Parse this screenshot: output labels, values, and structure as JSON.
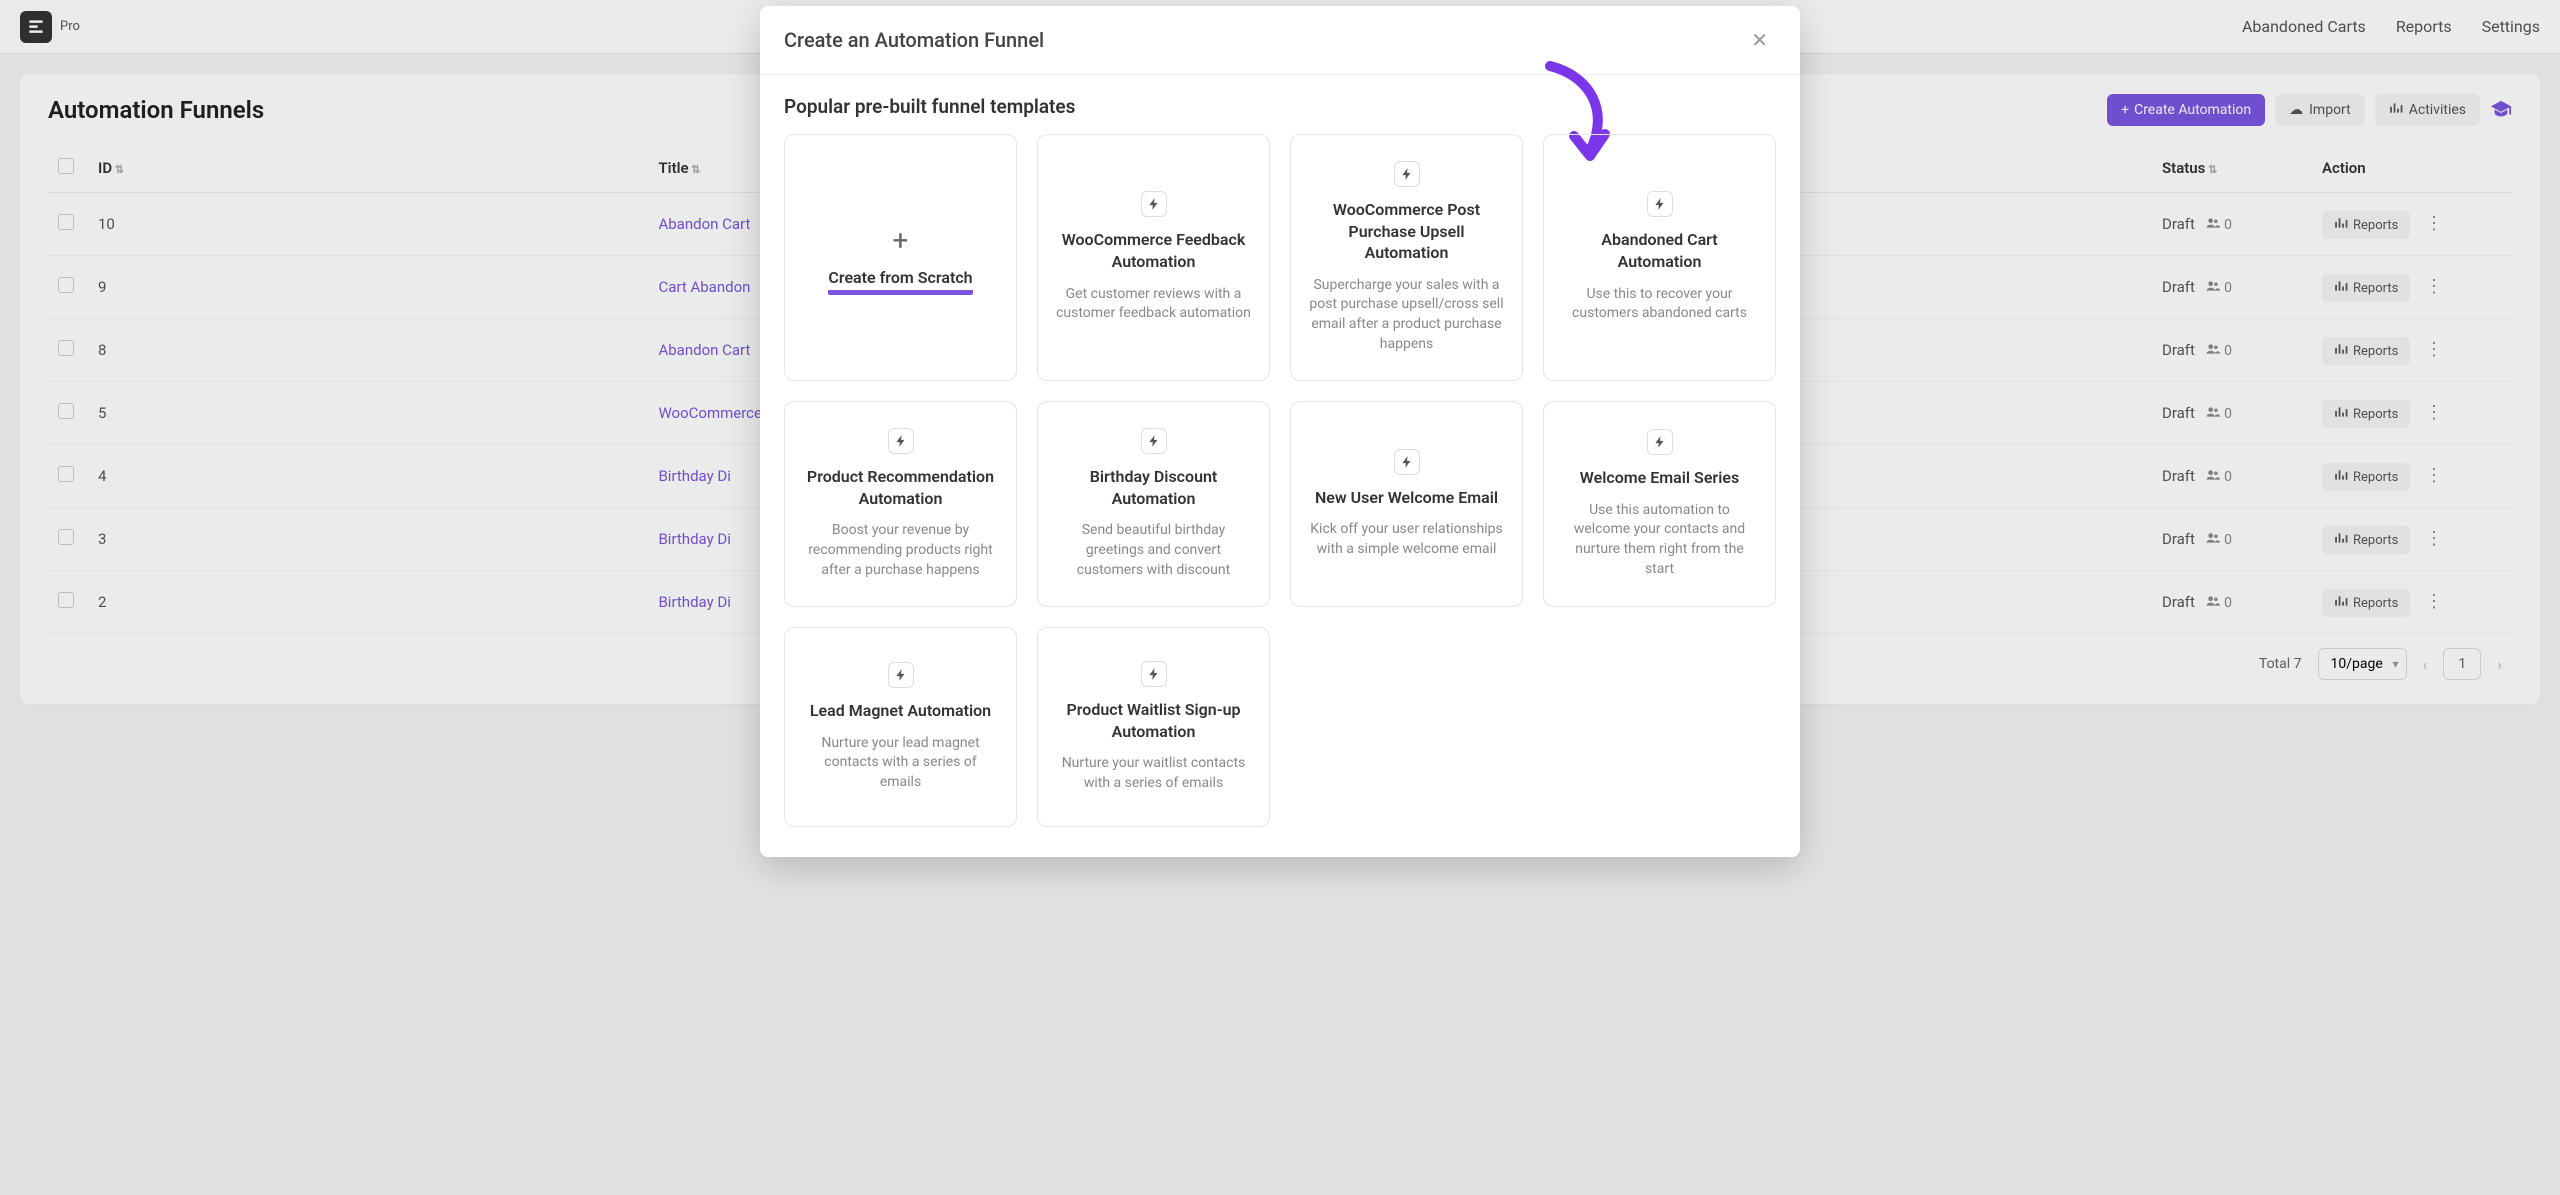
{
  "nav": {
    "pro_label": "Pro",
    "links": {
      "abandoned_carts": "Abandoned Carts",
      "reports": "Reports",
      "settings": "Settings"
    }
  },
  "page": {
    "title": "Automation Funnels",
    "actions": {
      "create": "Create Automation",
      "import": "Import",
      "activities": "Activities"
    }
  },
  "table": {
    "headers": {
      "id": "ID",
      "title": "Title",
      "status": "Status",
      "action": "Action"
    },
    "rows": [
      {
        "id": "10",
        "title": "Abandon Cart",
        "status": "Draft",
        "people": "0",
        "report_label": "Reports"
      },
      {
        "id": "9",
        "title": "Cart Abandon",
        "status": "Draft",
        "people": "0",
        "report_label": "Reports"
      },
      {
        "id": "8",
        "title": "Abandon Cart",
        "status": "Draft",
        "people": "0",
        "report_label": "Reports"
      },
      {
        "id": "5",
        "title": "WooCommerce",
        "status": "Draft",
        "people": "0",
        "report_label": "Reports"
      },
      {
        "id": "4",
        "title": "Birthday Di",
        "status": "Draft",
        "people": "0",
        "report_label": "Reports"
      },
      {
        "id": "3",
        "title": "Birthday Di",
        "status": "Draft",
        "people": "0",
        "report_label": "Reports"
      },
      {
        "id": "2",
        "title": "Birthday Di",
        "status": "Draft",
        "people": "0",
        "report_label": "Reports"
      }
    ],
    "footer": {
      "total_label": "Total 7",
      "page_size": "10/page",
      "current_page": "1"
    }
  },
  "modal": {
    "title": "Create an Automation Funnel",
    "section_title": "Popular pre-built funnel templates",
    "templates": [
      {
        "kind": "scratch",
        "title": "Create from Scratch"
      },
      {
        "kind": "bolt",
        "title": "WooCommerce Feedback Automation",
        "desc": "Get customer reviews with a customer feedback automation"
      },
      {
        "kind": "bolt",
        "title": "WooCommerce Post Purchase Upsell Automation",
        "desc": "Supercharge your sales with a post purchase upsell/cross sell email after a product purchase happens"
      },
      {
        "kind": "bolt",
        "title": "Abandoned Cart Automation",
        "desc": "Use this to recover your customers abandoned carts"
      },
      {
        "kind": "bolt",
        "title": "Product Recommendation Automation",
        "desc": "Boost your revenue by recommending products right after a purchase happens"
      },
      {
        "kind": "bolt",
        "title": "Birthday Discount Automation",
        "desc": "Send beautiful birthday greetings and convert customers with discount"
      },
      {
        "kind": "bolt",
        "title": "New User Welcome Email",
        "desc": "Kick off your user relationships with a simple welcome email"
      },
      {
        "kind": "bolt",
        "title": "Welcome Email Series",
        "desc": "Use this automation to welcome your contacts and nurture them right from the start"
      },
      {
        "kind": "bolt",
        "title": "Lead Magnet Automation",
        "desc": "Nurture your lead magnet contacts with a series of emails"
      },
      {
        "kind": "bolt",
        "title": "Product Waitlist Sign-up Automation",
        "desc": "Nurture your waitlist contacts with a series of emails"
      }
    ]
  },
  "colors": {
    "accent": "#7a56e0"
  }
}
